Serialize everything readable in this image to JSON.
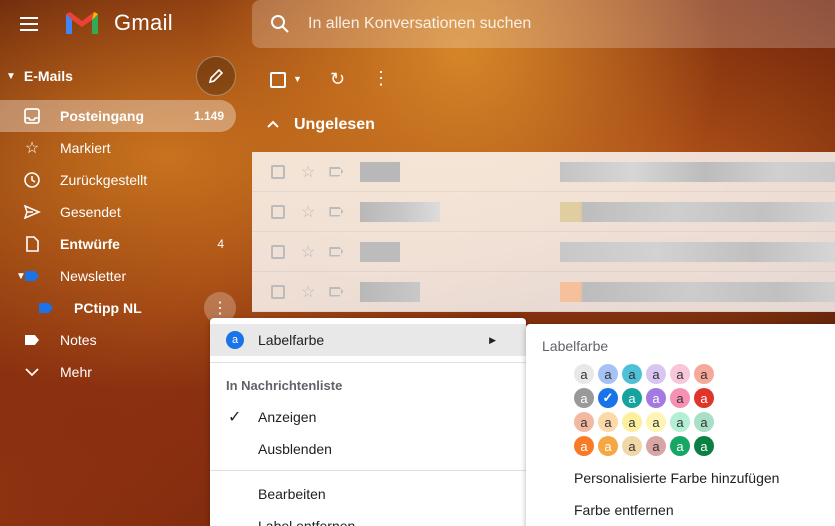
{
  "app": {
    "name": "Gmail"
  },
  "search": {
    "placeholder": "In allen Konversationen suchen"
  },
  "sidebar": {
    "section_label": "E-Mails",
    "items": [
      {
        "label": "Posteingang",
        "count": "1.149",
        "icon": "inbox-icon"
      },
      {
        "label": "Markiert",
        "count": "",
        "icon": "star-icon"
      },
      {
        "label": "Zurückgestellt",
        "count": "",
        "icon": "clock-icon"
      },
      {
        "label": "Gesendet",
        "count": "",
        "icon": "send-icon"
      },
      {
        "label": "Entwürfe",
        "count": "4",
        "icon": "draft-icon"
      },
      {
        "label": "Newsletter",
        "count": "",
        "icon": "label-icon"
      },
      {
        "label": "PCtipp NL",
        "count": "",
        "icon": "label-icon"
      },
      {
        "label": "Notes",
        "count": "",
        "icon": "label-icon"
      },
      {
        "label": "Mehr",
        "count": "",
        "icon": "chevron-down-icon"
      }
    ]
  },
  "main": {
    "section_title": "Ungelesen"
  },
  "context_menu": {
    "label_color": "Labelfarbe",
    "badge": "a",
    "in_list_heading": "In Nachrichtenliste",
    "show": "Anzeigen",
    "hide": "Ausblenden",
    "edit": "Bearbeiten",
    "remove_label": "Label entfernen"
  },
  "submenu": {
    "title": "Labelfarbe",
    "swatch_letter": "a",
    "add_custom": "Personalisierte Farbe hinzufügen",
    "remove_color": "Farbe entfernen",
    "swatches": [
      [
        "#e8e8e8",
        "#a4c2f4",
        "#4fc1d7",
        "#d9c6f0",
        "#f7c6d8",
        "#f6a89a"
      ],
      [
        "#999999",
        "#1a73e8",
        "#16a29f",
        "#a479e2",
        "#f691b3",
        "#e0352b"
      ],
      [
        "#f2b8a2",
        "#fcd9a8",
        "#fdef9f",
        "#fef4b4",
        "#b3efd3",
        "#a8dfc7"
      ],
      [
        "#f77b27",
        "#f4a742",
        "#f0d7a8",
        "#d8a4a4",
        "#16a765",
        "#0b8043"
      ]
    ],
    "selected_row": 1,
    "selected_col": 1
  }
}
